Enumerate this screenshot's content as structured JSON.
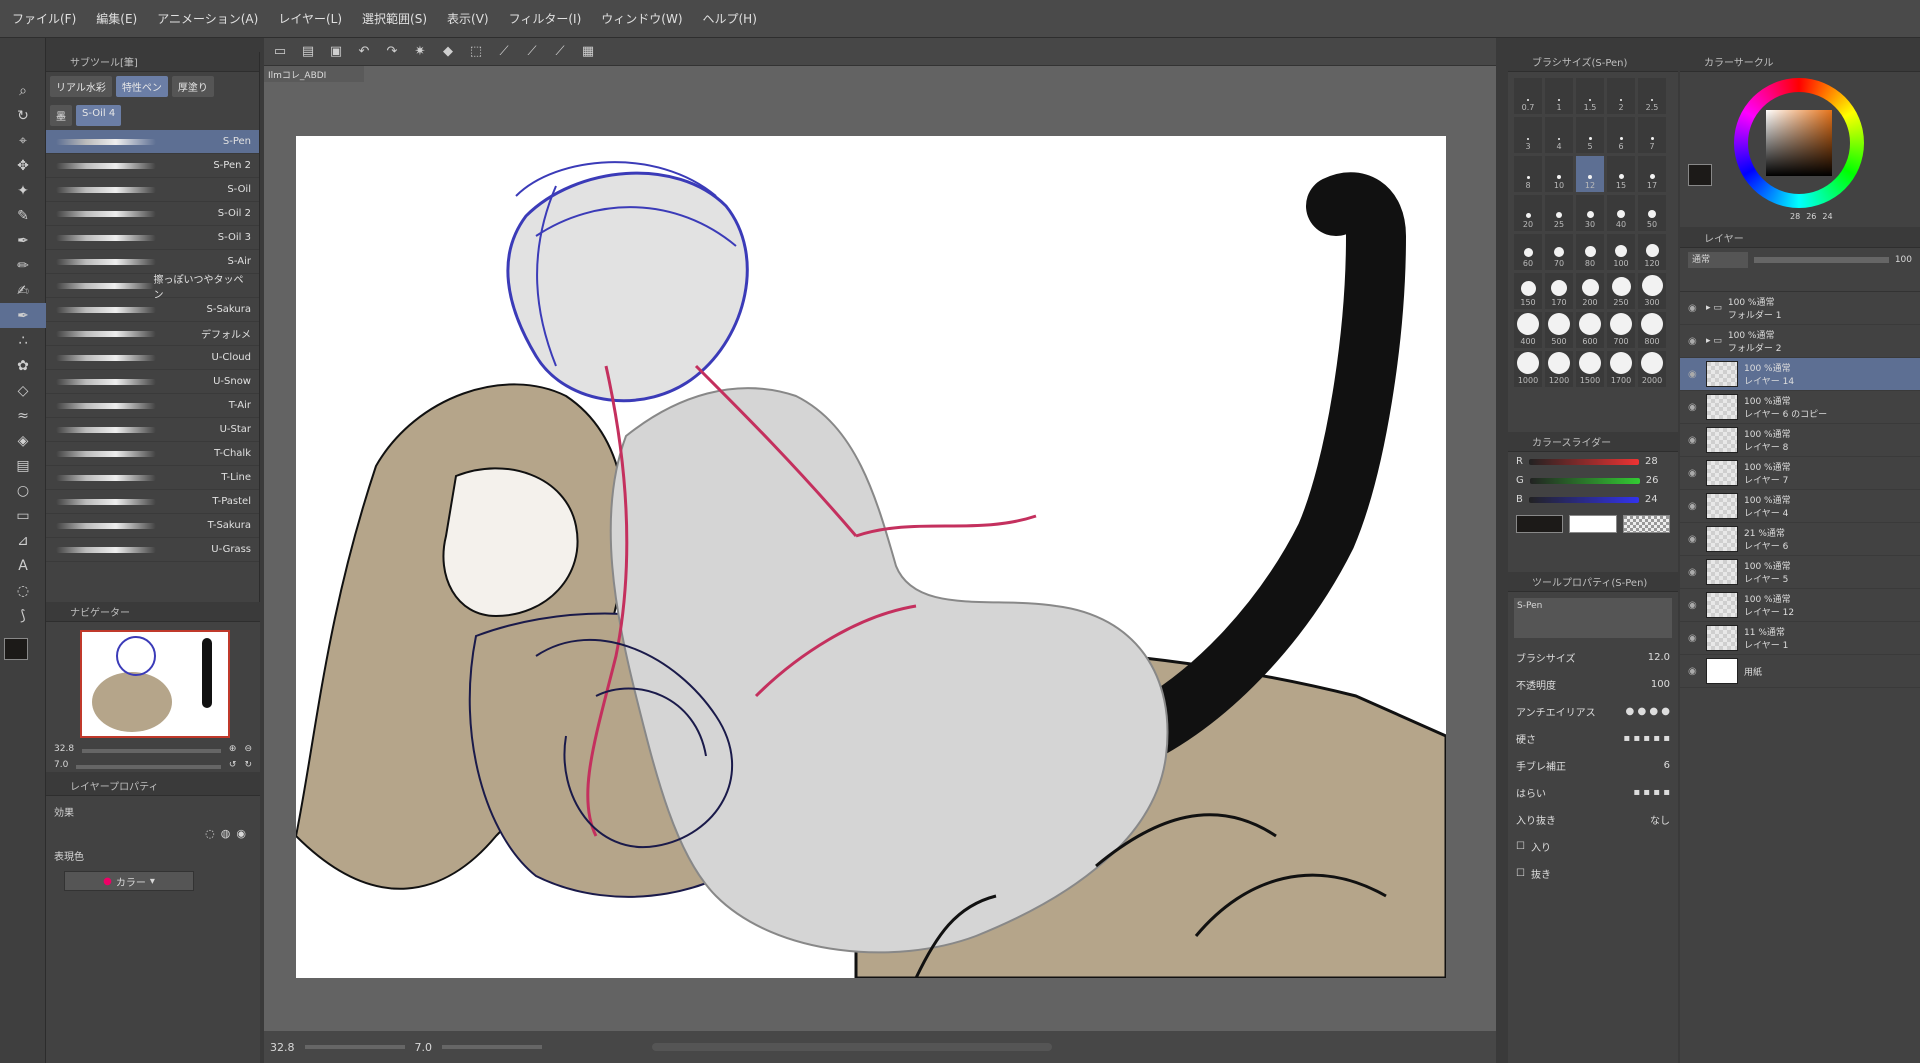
{
  "menu": [
    "ファイル(F)",
    "編集(E)",
    "アニメーション(A)",
    "レイヤー(L)",
    "選択範囲(S)",
    "表示(V)",
    "フィルター(I)",
    "ウィンドウ(W)",
    "ヘルプ(H)"
  ],
  "canvas_tab": "Ilmコレ_ABDI",
  "subtool": {
    "tabs": [
      "リアル水彩",
      "特性ペン",
      "厚塗り"
    ],
    "tabs2": [
      "墨",
      "S-Oil 4"
    ],
    "brushes": [
      "S-Pen",
      "S-Pen 2",
      "S-Oil",
      "S-Oil 2",
      "S-Oil 3",
      "S-Air",
      "擦っぽいつやタッペン",
      "S-Sakura",
      "デフォルメ",
      "U-Cloud",
      "U-Snow",
      "T-Air",
      "U-Star",
      "T-Chalk",
      "T-Line",
      "T-Pastel",
      "T-Sakura",
      "U-Grass"
    ]
  },
  "navigator": {
    "title": "ナビゲーター",
    "zoom": "32.8",
    "rotation": "7.0"
  },
  "layer_property": {
    "title": "レイヤープロパティ",
    "effect_label": "効果",
    "expression_label": "表現色",
    "expression_value": "カラー"
  },
  "brush_size": {
    "title": "ブラシサイズ(S-Pen)",
    "sizes": [
      "0.7",
      "1",
      "1.5",
      "2",
      "2.5",
      "3",
      "4",
      "5",
      "6",
      "7",
      "8",
      "10",
      "12",
      "15",
      "17",
      "20",
      "25",
      "30",
      "40",
      "50",
      "60",
      "70",
      "80",
      "100",
      "120",
      "150",
      "170",
      "200",
      "250",
      "300",
      "400",
      "500",
      "600",
      "700",
      "800",
      "1000",
      "1200",
      "1500",
      "1700",
      "2000"
    ],
    "selected": "12"
  },
  "color_slider": {
    "title": "カラースライダー",
    "r_label": "R",
    "g_label": "G",
    "b_label": "B",
    "r": "28",
    "g": "26",
    "b": "24"
  },
  "tool_property": {
    "title": "ツールプロパティ(S-Pen)",
    "brush_name": "S-Pen",
    "brush_size_label": "ブラシサイズ",
    "brush_size_value": "12.0",
    "opacity_label": "不透明度",
    "opacity_value": "100",
    "antialias_label": "アンチエイリアス",
    "stroke_label": "硬さ",
    "stabilize_label": "手ブレ補正",
    "stabilize_value": "6",
    "taper_label": "はらい",
    "in_out_label": "入り抜き",
    "in_out_value": "なし",
    "in_label": "入り",
    "out_label": "抜き"
  },
  "color_circle": {
    "title": "カラーサークル",
    "h": "28",
    "s": "26",
    "v": "24"
  },
  "layer_panel": {
    "title": "レイヤー",
    "blend_mode": "通常",
    "opacity": "100",
    "layers": [
      {
        "pct": "100 %通常",
        "name": "フォルダー 1",
        "type": "folder"
      },
      {
        "pct": "100 %通常",
        "name": "フォルダー 2",
        "type": "folder"
      },
      {
        "pct": "100 %通常",
        "name": "レイヤー 14",
        "type": "layer",
        "selected": true
      },
      {
        "pct": "100 %通常",
        "name": "レイヤー 6 のコピー",
        "type": "layer"
      },
      {
        "pct": "100 %通常",
        "name": "レイヤー 8",
        "type": "layer"
      },
      {
        "pct": "100 %通常",
        "name": "レイヤー 7",
        "type": "layer"
      },
      {
        "pct": "100 %通常",
        "name": "レイヤー 4",
        "type": "layer"
      },
      {
        "pct": "21 %通常",
        "name": "レイヤー 6",
        "type": "layer"
      },
      {
        "pct": "100 %通常",
        "name": "レイヤー 5",
        "type": "layer"
      },
      {
        "pct": "100 %通常",
        "name": "レイヤー 12",
        "type": "layer"
      },
      {
        "pct": "11 %通常",
        "name": "レイヤー 1",
        "type": "layer"
      },
      {
        "pct": "",
        "name": "用紙",
        "type": "paper"
      }
    ]
  },
  "status": {
    "zoom": "32.8",
    "angle": "7.0"
  },
  "colors": {
    "main": "#1c1a18",
    "sub": "#ffffff",
    "accent": "#5d6f93"
  }
}
